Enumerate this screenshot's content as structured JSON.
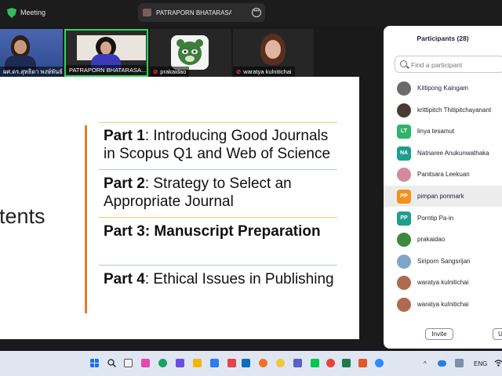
{
  "topbar": {
    "title": "Meeting",
    "share_name": "PATRAPORN BHATARASAKOON's"
  },
  "strip": {
    "tiles": [
      {
        "name": "ผศ.ดร.สุทธิดา พงษ์พันธ์งาม",
        "muted": false
      },
      {
        "name": "PATRAPORN BHATARASA...",
        "muted": false
      },
      {
        "name": "prakaidao",
        "muted": true
      },
      {
        "name": "waratya kulnitichai",
        "muted": true
      }
    ]
  },
  "slide": {
    "side_word": "tents",
    "parts": [
      {
        "label": "Part 1",
        "text": ": Introducing Good Journals in Scopus Q1 and Web of Science"
      },
      {
        "label": "Part 2",
        "text": ": Strategy to Select an Appropriate Journal"
      },
      {
        "label": "Part 3",
        "text": ": Manuscript Preparation"
      },
      {
        "label": "Part 4",
        "text": ": Ethical Issues in Publishing"
      }
    ]
  },
  "participants": {
    "title": "Participants (28)",
    "search_placeholder": "Find a participant",
    "list": [
      {
        "name": "Kittipong Kaingam",
        "initials": "",
        "color": "#6b6b6b",
        "photo": true
      },
      {
        "name": "krittipitch Thitipitchayanant",
        "initials": "",
        "color": "#4a3a33",
        "photo": true
      },
      {
        "name": "linya tesamut",
        "initials": "LT",
        "color": "#2eb36b",
        "photo": false
      },
      {
        "name": "Natnaree Anukunwathaka",
        "initials": "NA",
        "color": "#1e9e8d",
        "photo": false
      },
      {
        "name": "Panitsara Leekuan",
        "initials": "",
        "color": "#d28aa0",
        "photo": true
      },
      {
        "name": "pimpan ponmark",
        "initials": "PP",
        "color": "#f0921e",
        "photo": false
      },
      {
        "name": "Porntip Pa-in",
        "initials": "PP",
        "color": "#1e9e8d",
        "photo": false
      },
      {
        "name": "prakaidao",
        "initials": "",
        "color": "#3c8a3c",
        "photo": true
      },
      {
        "name": "Siriporn Sangsrijan",
        "initials": "",
        "color": "#7fa6c8",
        "photo": true
      },
      {
        "name": "waratya kulnitichai",
        "initials": "",
        "color": "#b06a4e",
        "photo": true
      },
      {
        "name": "waratya kulnitichai",
        "initials": "",
        "color": "#b06a4e",
        "photo": true
      }
    ],
    "invite_label": "Invite",
    "second_button_label": "U"
  },
  "taskbar": {
    "language": "ENG",
    "tray_up": "^"
  }
}
